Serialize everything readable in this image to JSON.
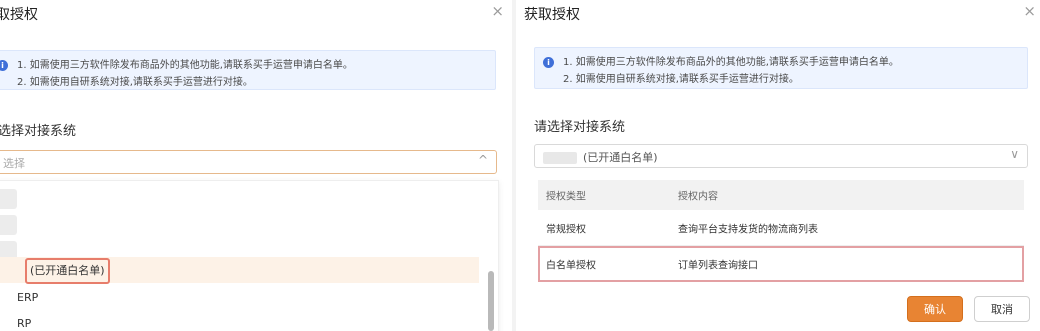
{
  "left_dialog": {
    "title": "取授权",
    "close_glyph": "×",
    "notice_lines": [
      "1. 如需使用三方软件除发布商品外的其他功能,请联系买手运营申请白名单。",
      "2. 如需使用自研系统对接,请联系买手运营进行对接。"
    ],
    "field_label": "选择对接系统",
    "select_placeholder": "选择",
    "chevron_glyph": "^",
    "options": [
      {
        "tag": "(已开通白名单)"
      },
      {
        "text": "ERP"
      },
      {
        "text": "RP"
      }
    ]
  },
  "right_dialog": {
    "title": "获取授权",
    "close_glyph": "×",
    "notice_lines": [
      "1. 如需使用三方软件除发布商品外的其他功能,请联系买手运营申请白名单。",
      "2. 如需使用自研系统对接,请联系买手运营进行对接。"
    ],
    "field_label": "请选择对接系统",
    "selected_value": "(已开通白名单)",
    "chevron_glyph": "∨",
    "table": {
      "headers": [
        "授权类型",
        "授权内容"
      ],
      "rows": [
        [
          "常规授权",
          "查询平台支持发货的物流商列表"
        ],
        [
          "白名单授权",
          "订单列表查询接口"
        ]
      ]
    },
    "confirm_label": "确认",
    "cancel_label": "取消"
  },
  "icons": {
    "info": "info-icon",
    "close": "close-icon",
    "chevron": "chevron-icon"
  },
  "colors": {
    "accent": "#e88433",
    "notice_bg": "#eef4ff",
    "highlight_border": "#e77d6b"
  }
}
